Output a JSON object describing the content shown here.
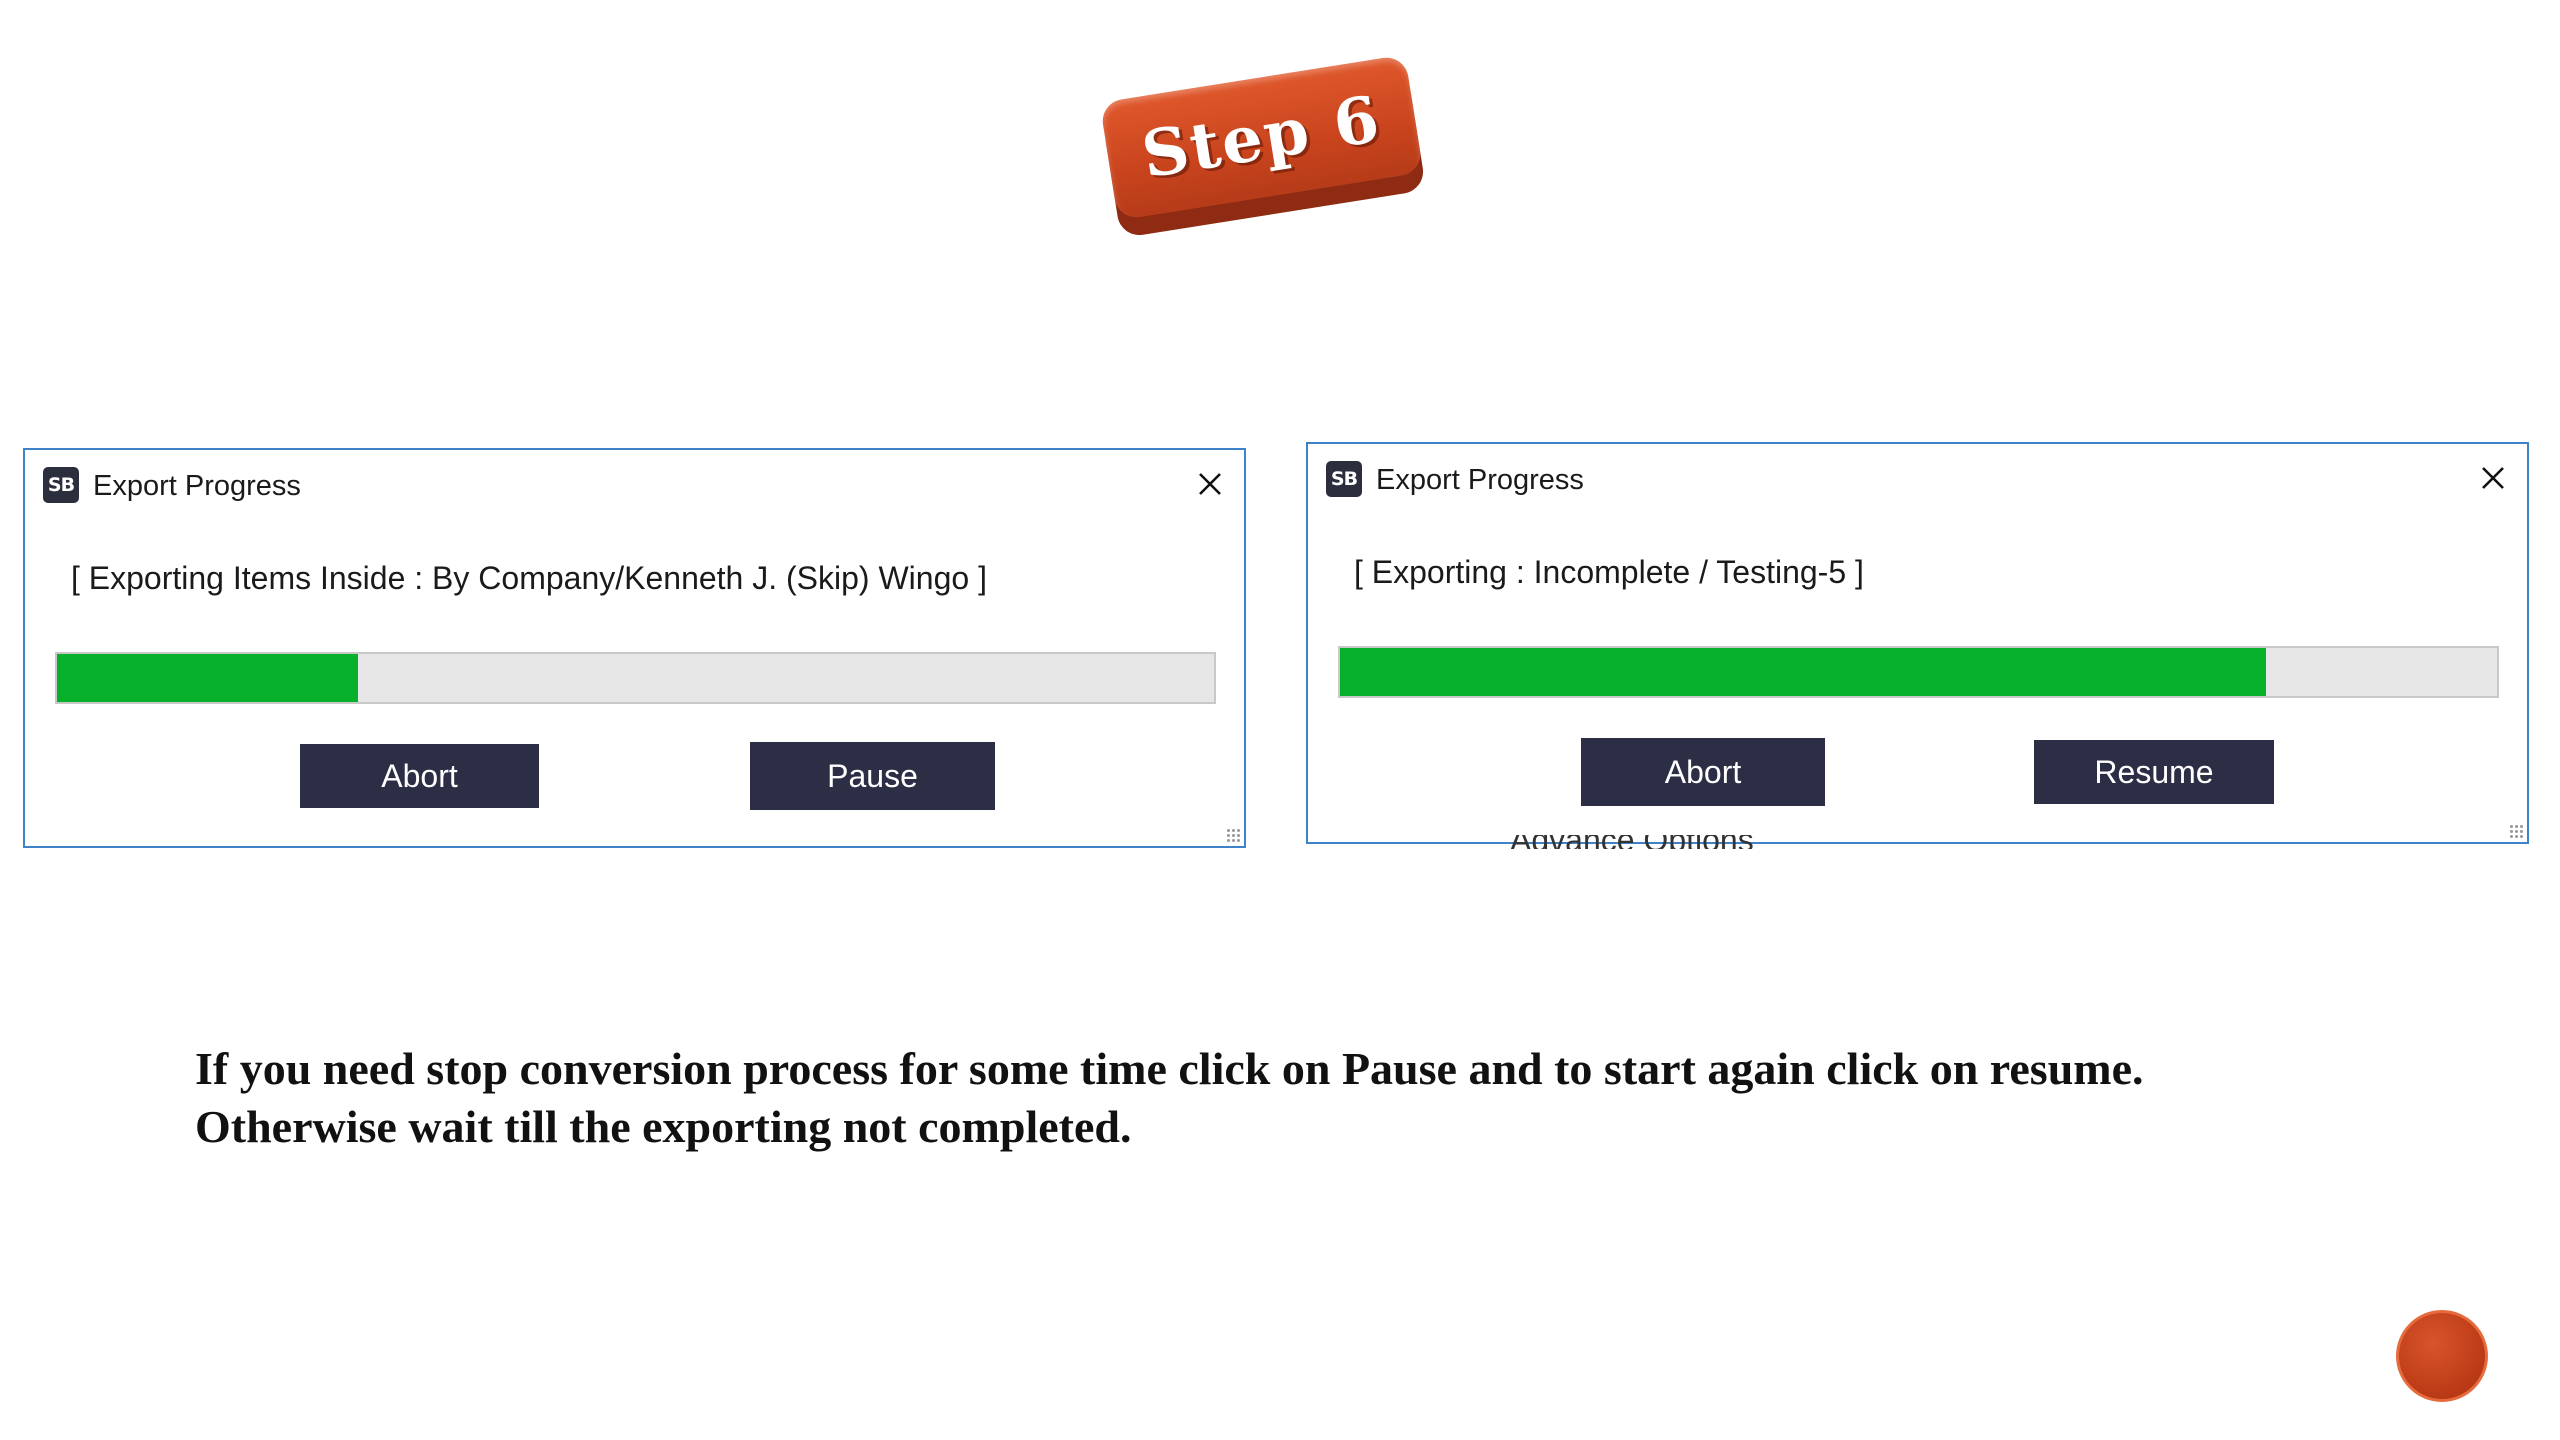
{
  "step_badge": {
    "label": "Step 6"
  },
  "windows": [
    {
      "title": "Export Progress",
      "app_icon": "SB",
      "status": "[ Exporting Items Inside : By Company/Kenneth J. (Skip) Wingo ]",
      "progress_fraction": 0.26,
      "buttons": {
        "primary": "Abort",
        "secondary": "Pause"
      }
    },
    {
      "title": "Export Progress",
      "app_icon": "SB",
      "status": "[ Exporting : Incomplete / Testing-5 ]",
      "progress_fraction": 0.8,
      "buttons": {
        "primary": "Abort",
        "secondary": "Resume"
      },
      "underlying_text": "Advance Options"
    }
  ],
  "instructions": {
    "line1": "If you need stop conversion process for some time click on Pause and to start again click on resume.",
    "line2": "Otherwise wait till the exporting not completed."
  },
  "colors": {
    "progress": "#06b02a",
    "button": "#2b2e45",
    "window_border": "#3e82c9",
    "badge": "#c9441d"
  }
}
